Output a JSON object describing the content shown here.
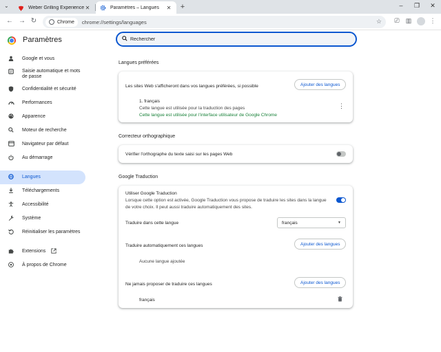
{
  "browser": {
    "tabs": [
      {
        "title": "Weber Grilling Experience",
        "icon": "weber-favicon",
        "active": false
      },
      {
        "title": "Paramètres – Langues",
        "icon": "settings-gear-favicon",
        "active": true
      }
    ],
    "url_chip": "Chrome",
    "url": "chrome://settings/languages"
  },
  "settings": {
    "title": "Paramètres",
    "search_placeholder": "Rechercher"
  },
  "sidebar": {
    "items": [
      {
        "label": "Google et vous",
        "icon": "person-icon"
      },
      {
        "label": "Saisie automatique et mots de passe",
        "icon": "autofill-icon"
      },
      {
        "label": "Confidentialité et sécurité",
        "icon": "shield-icon"
      },
      {
        "label": "Performances",
        "icon": "speedometer-icon"
      },
      {
        "label": "Apparence",
        "icon": "palette-icon"
      },
      {
        "label": "Moteur de recherche",
        "icon": "search-icon"
      },
      {
        "label": "Navigateur par défaut",
        "icon": "browser-window-icon"
      },
      {
        "label": "Au démarrage",
        "icon": "power-icon"
      },
      {
        "label": "Langues",
        "icon": "globe-icon",
        "selected": true
      },
      {
        "label": "Téléchargements",
        "icon": "download-icon"
      },
      {
        "label": "Accessibilité",
        "icon": "accessibility-icon"
      },
      {
        "label": "Système",
        "icon": "wrench-icon"
      },
      {
        "label": "Réinitialiser les paramètres",
        "icon": "reset-icon"
      },
      {
        "label": "Extensions",
        "icon": "puzzle-icon"
      },
      {
        "label": "À propos de Chrome",
        "icon": "chrome-icon"
      }
    ]
  },
  "languages": {
    "section_title": "Langues préférées",
    "description": "Les sites Web s'afficheront dans vos langues préférées, si possible",
    "add_button": "Ajouter des langues",
    "entry_name": "1. français",
    "entry_line1": "Cette langue est utilisée pour la traduction des pages",
    "entry_line2": "Cette langue est utilisée pour l'interface utilisateur de Google Chrome"
  },
  "spellcheck": {
    "section_title": "Correcteur orthographique",
    "label": "Vérifier l'orthographe du texte saisi sur les pages Web",
    "enabled": false
  },
  "translate": {
    "section_title": "Google Traduction",
    "use_title": "Utiliser Google Traduction",
    "use_desc1": "Lorsque cette option est activée, Google Traduction vous propose de traduire les sites dans la langue",
    "use_desc2": "de votre choix. Il peut aussi traduire automatiquement des sites.",
    "enabled": true,
    "target_label": "Traduire dans cette langue",
    "target_value": "français",
    "auto_label": "Traduire automatiquement ces langues",
    "auto_add": "Ajouter des langues",
    "auto_empty": "Aucune langue ajoutée",
    "never_label": "Ne jamais proposer de traduire ces langues",
    "never_add": "Ajouter des langues",
    "never_item": "français"
  }
}
